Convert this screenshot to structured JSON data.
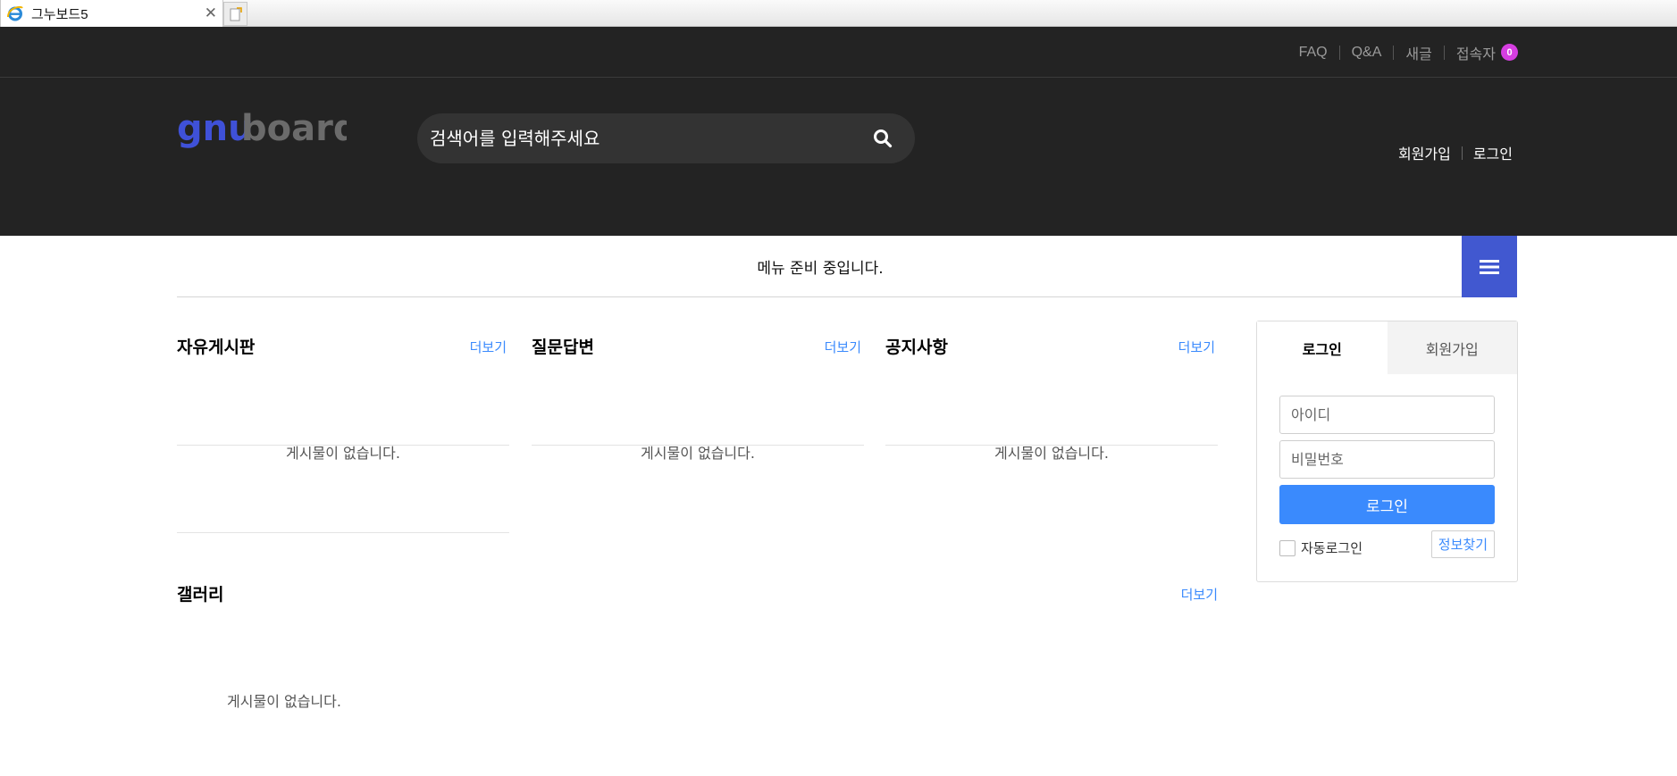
{
  "browser": {
    "tab_title": "그누보드5"
  },
  "top_bar": {
    "links": [
      "FAQ",
      "Q&A",
      "새글",
      "접속자"
    ],
    "visitor_count": "0",
    "badge_color": "#d63ee1"
  },
  "header": {
    "logo_text_a": "gnu",
    "logo_text_b": "board",
    "search_placeholder": "검색어를 입력해주세요",
    "links": [
      "회원가입",
      "로그인"
    ]
  },
  "nav": {
    "message": "메뉴 준비 중입니다.",
    "menu_button_color": "#4158d0"
  },
  "boards": [
    {
      "title": "자유게시판",
      "more": "더보기",
      "empty": "게시물이 없습니다."
    },
    {
      "title": "질문답변",
      "more": "더보기",
      "empty": "게시물이 없습니다."
    },
    {
      "title": "공지사항",
      "more": "더보기",
      "empty": "게시물이 없습니다."
    }
  ],
  "gallery": {
    "title": "갤러리",
    "more": "더보기",
    "empty": "게시물이 없습니다."
  },
  "login_box": {
    "tab_login": "로그인",
    "tab_join": "회원가입",
    "id_placeholder": "아이디",
    "pw_placeholder": "비밀번호",
    "submit_label": "로그인",
    "auto_login_label": "자동로그인",
    "find_info_label": "정보찾기",
    "accent_color": "#3a8afd"
  }
}
